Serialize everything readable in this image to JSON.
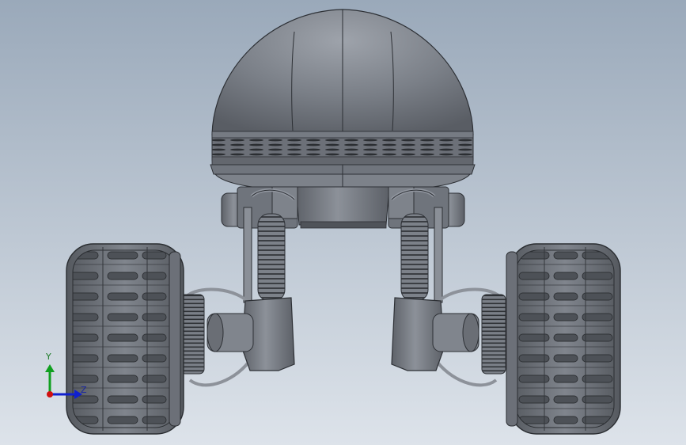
{
  "viewport": {
    "background_top": "#9aa9ba",
    "background_bottom": "#dde3ea",
    "model_color": "#6f747c"
  },
  "triad": {
    "y_label": "Y",
    "z_label": "Z",
    "x_color": "#d01010",
    "y_color": "#10a020",
    "z_color": "#1020d0"
  },
  "icons": {
    "origin": "coordinate-triad-icon"
  }
}
